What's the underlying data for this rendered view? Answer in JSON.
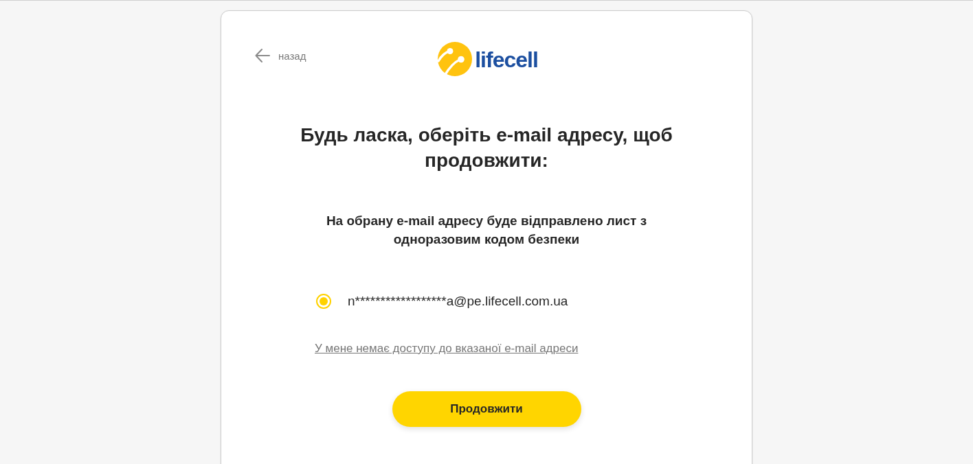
{
  "header": {
    "back_label": "назад",
    "logo_text": "lifecell"
  },
  "title": "Будь ласка, оберіть e-mail адресу, щоб продовжити:",
  "subtitle": "На обрану e-mail адресу буде відправлено лист з одноразовим кодом безпеки",
  "email_options": [
    {
      "label": "n******************a@pe.lifecell.com.ua",
      "selected": true
    }
  ],
  "no_access_link": "У мене немає доступу до вказаної e-mail адреси",
  "continue_button": "Продовжити"
}
